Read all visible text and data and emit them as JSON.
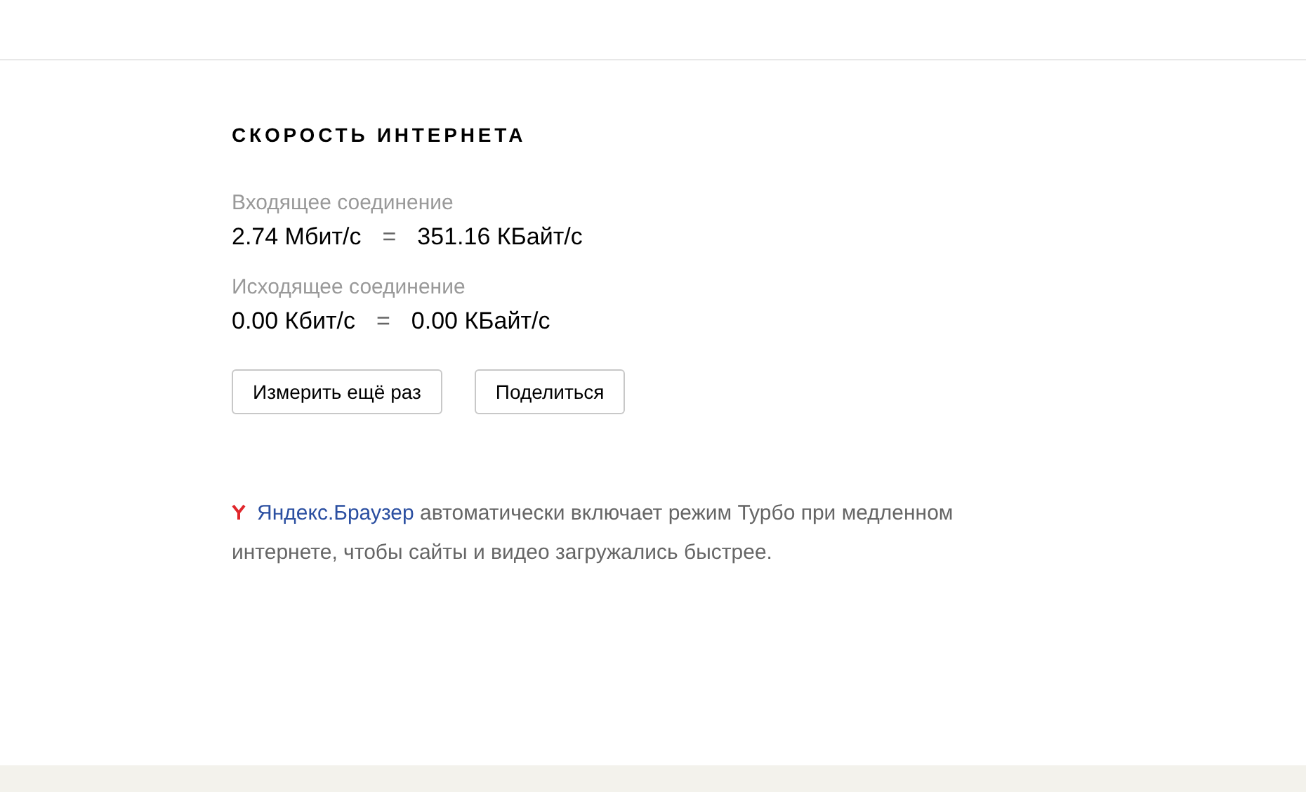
{
  "title": "СКОРОСТЬ ИНТЕРНЕТА",
  "results": [
    {
      "label": "Входящее соединение",
      "bits": "2.74 Мбит/с",
      "equals": "=",
      "bytes": "351.16 КБайт/с"
    },
    {
      "label": "Исходящее соединение",
      "bits": "0.00 Кбит/с",
      "equals": "=",
      "bytes": "0.00 КБайт/с"
    }
  ],
  "buttons": [
    "Измерить ещё раз",
    "Поделиться"
  ],
  "promo": {
    "link": "Яндекс.Браузер",
    "text": " автоматически включает режим Турбо при медленном интернете, чтобы сайты и видео загружались быстрее."
  }
}
